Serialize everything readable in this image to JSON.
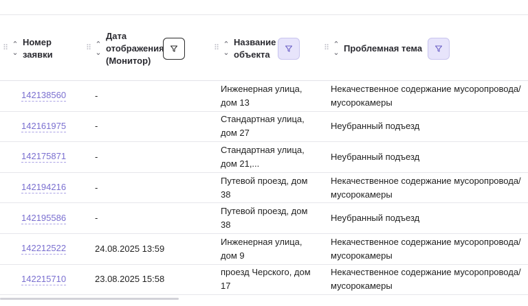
{
  "columns": {
    "number": "Номер заявки",
    "date": "Дата отображения (Монитор)",
    "object": "Название объекта",
    "topic": "Проблемная тема"
  },
  "rows": [
    {
      "number": "142138560",
      "date": "-",
      "object": "Инженерная улица, дом 13",
      "topic": "Некачественное содержание мусоропровода/ мусорокамеры"
    },
    {
      "number": "142161975",
      "date": "-",
      "object": "Стандартная улица, дом 27",
      "topic": "Неубранный подъезд"
    },
    {
      "number": "142175871",
      "date": "-",
      "object": "Стандартная улица, дом 21,...",
      "topic": "Неубранный подъезд"
    },
    {
      "number": "142194216",
      "date": "-",
      "object": "Путевой проезд, дом 38",
      "topic": "Некачественное содержание мусоропровода/ мусорокамеры"
    },
    {
      "number": "142195586",
      "date": "-",
      "object": "Путевой проезд, дом 38",
      "topic": "Неубранный подъезд"
    },
    {
      "number": "142212522",
      "date": "24.08.2025 13:59",
      "object": "Инженерная улица, дом 9",
      "topic": "Некачественное содержание мусоропровода/ мусорокамеры"
    },
    {
      "number": "142215710",
      "date": "23.08.2025 15:58",
      "object": "проезд Черского, дом 17",
      "topic": "Некачественное содержание мусоропровода/ мусорокамеры"
    }
  ],
  "icons": {
    "grip": "drag-handle-icon",
    "sort": "sort-arrows-icon",
    "filter": "filter-funnel-icon"
  },
  "colors": {
    "link": "#7a6fd0",
    "filter_active_bg": "#e7e4fb",
    "divider": "#e6e6eb"
  }
}
